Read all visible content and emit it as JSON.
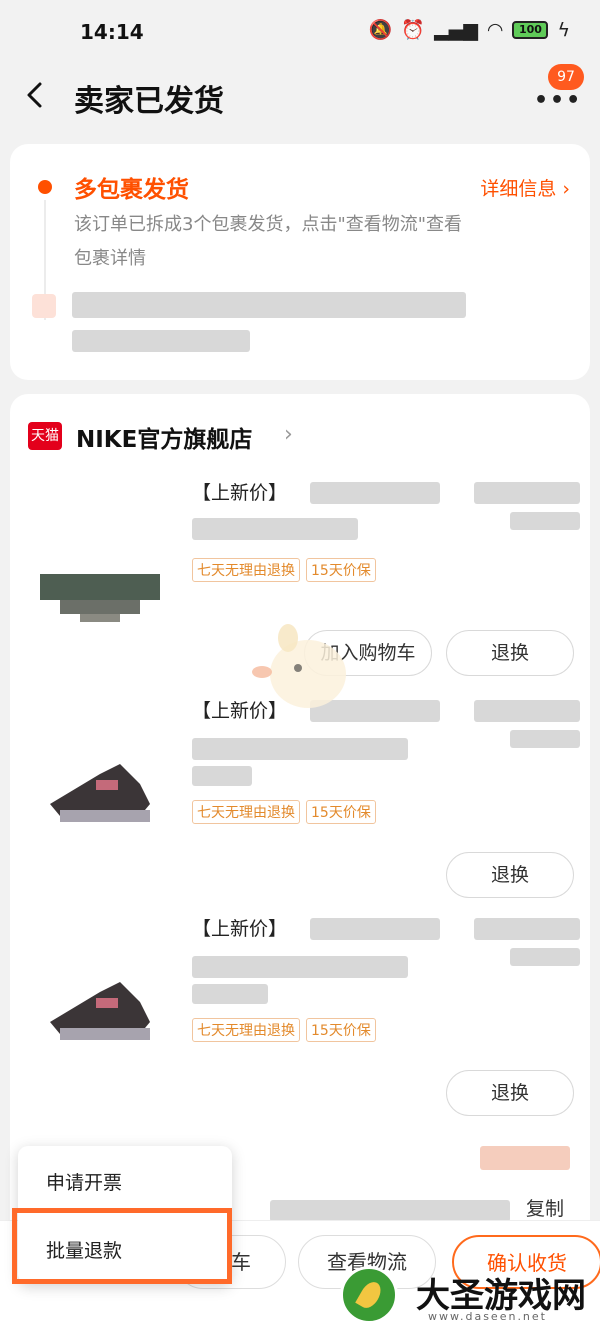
{
  "status_bar": {
    "time": "14:14",
    "battery": "100",
    "icons": [
      "mute-icon",
      "alarm-icon",
      "signal-icon",
      "wifi-icon",
      "battery-icon",
      "charging-icon"
    ]
  },
  "header": {
    "title": "卖家已发货",
    "badge_count": "97",
    "more_glyph": "•••"
  },
  "shipment": {
    "title": "多包裹发货",
    "detail_link": "详细信息 ›",
    "description": "该订单已拆成3个包裹发货，点击\"查看物流\"查看包裹详情"
  },
  "store": {
    "logo_text": "天猫",
    "name": "NIKE官方旗舰店",
    "arrow": "›"
  },
  "products": [
    {
      "title": "【上新价】",
      "tags": [
        "七天无理由退换",
        "15天价保"
      ],
      "buttons": {
        "cart": "加入购物车",
        "refund": "退换"
      }
    },
    {
      "title": "【上新价】",
      "tags": [
        "七天无理由退换",
        "15天价保"
      ],
      "buttons": {
        "refund": "退换"
      }
    },
    {
      "title": "【上新价】",
      "tags": [
        "七天无理由退换",
        "15天价保"
      ],
      "buttons": {
        "refund": "退换"
      }
    }
  ],
  "copy_label": "复制",
  "popup_menu": {
    "items": [
      "申请开票",
      "批量退款"
    ]
  },
  "bottom_bar": {
    "cart": "物车",
    "logistics": "查看物流",
    "confirm": "确认收货"
  },
  "colors": {
    "accent": "#ff5000",
    "tmall_red": "#e3001b",
    "highlight": "#ff6a2a"
  },
  "watermark": {
    "name": "大圣游戏网",
    "url": "www.daseen.net"
  }
}
